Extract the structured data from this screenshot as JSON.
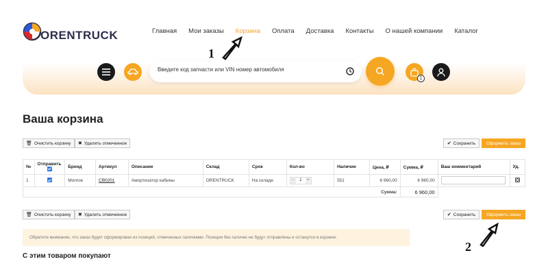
{
  "header": {
    "logo_text": "ORENTRUCK",
    "nav": [
      "Главная",
      "Мои заказы",
      "Корзина",
      "Оплата",
      "Доставка",
      "Контакты",
      "О нашей компании",
      "Каталог"
    ],
    "active_nav": "Корзина",
    "search_placeholder": "Введите код запчасти или VIN номер автомобиля",
    "cart_count": "1"
  },
  "annotations": [
    "1",
    "2"
  ],
  "page": {
    "title": "Ваша корзина",
    "clear_cart": "Очистить корзину",
    "delete_selected": "Удалить отмеченное",
    "save": "Сохранить",
    "checkout": "Оформить заказ"
  },
  "table": {
    "headers": [
      "№",
      "Отправить",
      "Бренд",
      "Артикул",
      "Описание",
      "Склад",
      "Срок",
      "Кол-во",
      "Наличие",
      "Цена, ₽",
      "Сумма, ₽",
      "Ваш комментарий",
      "Уд."
    ],
    "rows": [
      {
        "num": "1",
        "send": true,
        "brand": "Monroe",
        "article": "CB0201",
        "description": "Амортизатор кабины",
        "warehouse": "ORENTRUCK",
        "term": "На складе",
        "qty": "1",
        "stock": "551",
        "price": "6 960,00",
        "sum": "6 960,00",
        "comment": ""
      }
    ],
    "total_label": "Сумма:",
    "total_value": "6 960,00"
  },
  "notice": "Обратите внимание, что заказ будет сформирован из позиций, отмеченных галочками. Позиции без галочек не будут отправлены и останутся в корзине.",
  "also_buy_title": "С этим товаром покупают",
  "colors": {
    "accent": "#f5a623",
    "dark": "#1a1a1a",
    "checkbox": "#2a7ae2",
    "notice_bg": "#fdf3df"
  }
}
